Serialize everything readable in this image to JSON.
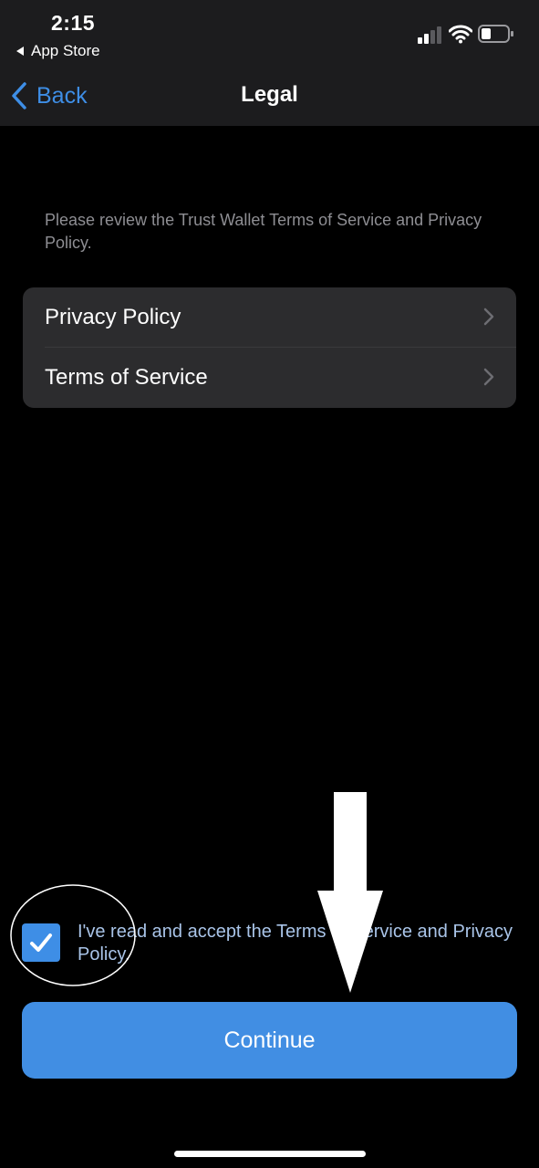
{
  "status_bar": {
    "time": "2:15",
    "back_app_label": "App Store"
  },
  "nav": {
    "back_label": "Back",
    "title": "Legal"
  },
  "intro_text": "Please review the Trust Wallet Terms of Service and Privacy Policy.",
  "legal_items": [
    {
      "label": "Privacy Policy"
    },
    {
      "label": "Terms of Service"
    }
  ],
  "accept": {
    "checked": true,
    "text": "I've read and accept the Terms of Service and Privacy Policy."
  },
  "continue_button": {
    "label": "Continue"
  },
  "colors": {
    "accent": "#3e8ee6",
    "bar_background": "#1c1c1e",
    "list_background": "#2c2c2e"
  }
}
